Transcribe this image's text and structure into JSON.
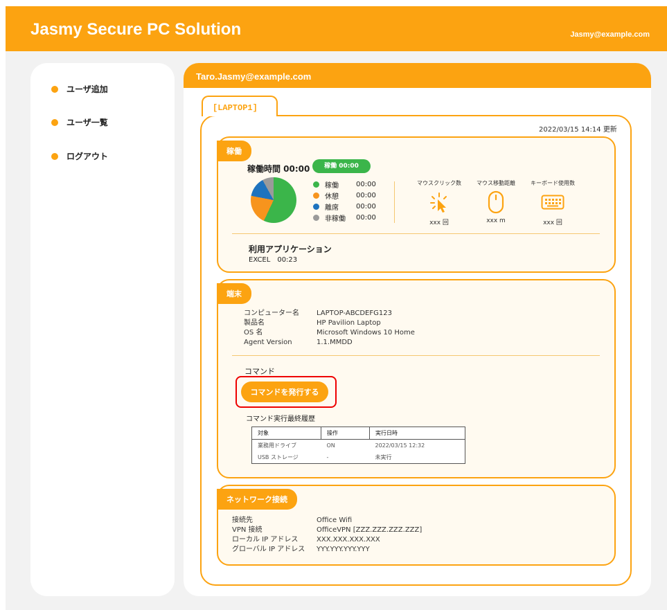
{
  "header": {
    "title": "Jasmy Secure PC Solution",
    "user_email": "Jasmy@example.com"
  },
  "sidebar": {
    "items": [
      {
        "label": "ユーザ追加"
      },
      {
        "label": "ユーザ一覧"
      },
      {
        "label": "ログアウト"
      }
    ]
  },
  "main": {
    "user_email": "Taro.Jasmy@example.com"
  },
  "device": {
    "name": "[LAPTOP1]",
    "updated": "2022/03/15 14:14 更新"
  },
  "operation": {
    "section_label": "稼働",
    "uptime_label": "稼働時間 00:00",
    "uptime_badge": "稼働 00:00",
    "pie": [
      {
        "name": "稼働",
        "time": "00:00",
        "color": "#3BB54A",
        "value": 57
      },
      {
        "name": "休憩",
        "time": "00:00",
        "color": "#F7941D",
        "value": 21
      },
      {
        "name": "離席",
        "time": "00:00",
        "color": "#1E73BE",
        "value": 14
      },
      {
        "name": "非稼働",
        "time": "00:00",
        "color": "#9A9A9A",
        "value": 8
      }
    ],
    "metrics": [
      {
        "label": "マウスクリック数",
        "value": "xxx 回",
        "icon": "click-icon"
      },
      {
        "label": "マウス移動距離",
        "value": "xxx m",
        "icon": "mouse-icon"
      },
      {
        "label": "キーボード使用数",
        "value": "xxx 回",
        "icon": "keyboard-icon"
      }
    ],
    "apps_title": "利用アプリケーション",
    "apps": [
      {
        "name": "EXCEL",
        "time": "00:23"
      }
    ]
  },
  "terminal": {
    "section_label": "端末",
    "info": [
      {
        "key": "コンピューター名",
        "value": "LAPTOP-ABCDEFG123"
      },
      {
        "key": "製品名",
        "value": "HP Pavilion Laptop"
      },
      {
        "key": "OS 名",
        "value": "Microsoft Windows 10 Home"
      },
      {
        "key": "Agent Version",
        "value": "1.1.MMDD"
      }
    ],
    "command_title": "コマンド",
    "command_button": "コマンドを発行する",
    "history_title": "コマンド実行最終履歴",
    "history_headers": [
      "対象",
      "操作",
      "実行日時"
    ],
    "history_rows": [
      [
        "業務用ドライブ",
        "ON",
        "2022/03/15 12:32"
      ],
      [
        "USB ストレージ",
        "-",
        "未実行"
      ]
    ]
  },
  "network": {
    "section_label": "ネットワーク接続",
    "info": [
      {
        "key": "接続先",
        "value": "Office Wifi"
      },
      {
        "key": "VPN 接続",
        "value": "OfficeVPN [ZZZ.ZZZ.ZZZ.ZZZ]"
      },
      {
        "key": "ローカル IP アドレス",
        "value": "XXX.XXX.XXX.XXX"
      },
      {
        "key": "グローバル IP アドレス",
        "value": "YYY.YYY.YYY.YYY"
      }
    ]
  },
  "colors": {
    "accent": "#FCA311",
    "section_bg": "#FFFAF0",
    "active": "#3BB54A",
    "highlight": "#EE0000"
  }
}
